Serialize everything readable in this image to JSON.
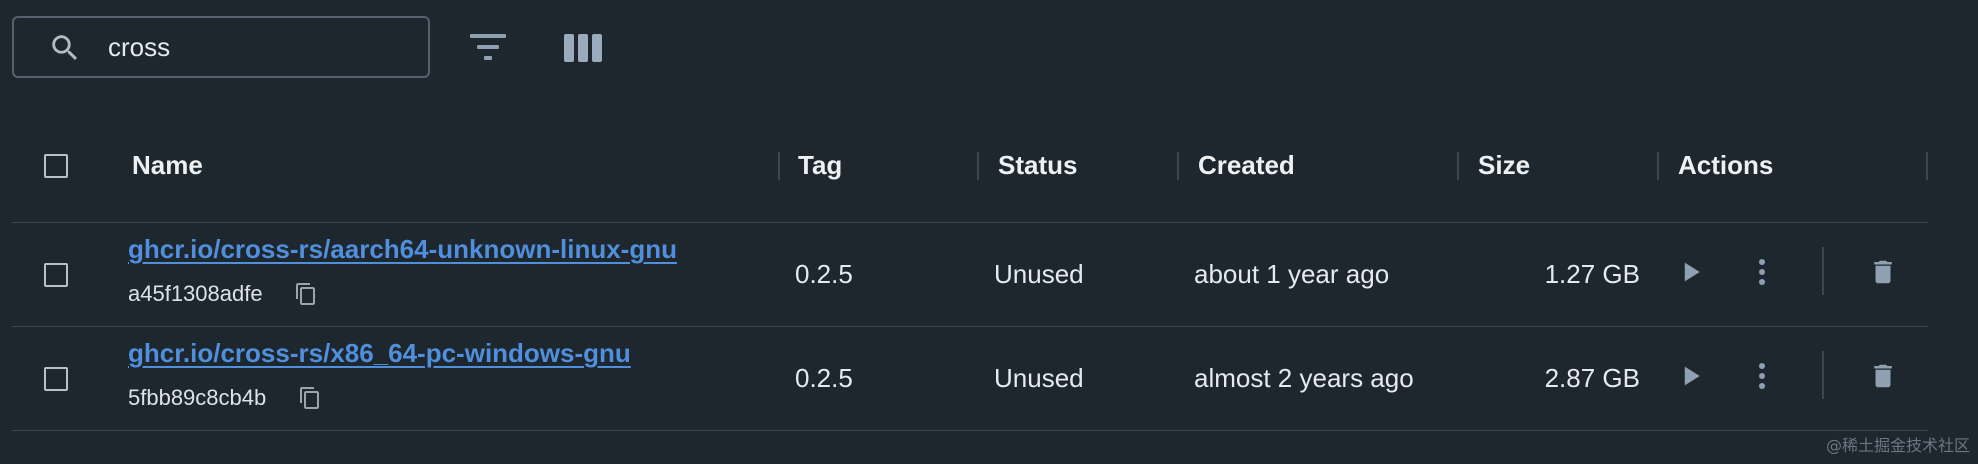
{
  "search": {
    "value": "cross"
  },
  "table": {
    "columns": [
      "Name",
      "Tag",
      "Status",
      "Created",
      "Size",
      "Actions"
    ],
    "rows": [
      {
        "name": "ghcr.io/cross-rs/aarch64-unknown-linux-gnu",
        "id": "a45f1308adfe",
        "tag": "0.2.5",
        "status": "Unused",
        "created": "about 1 year ago",
        "size": "1.27 GB"
      },
      {
        "name": "ghcr.io/cross-rs/x86_64-pc-windows-gnu",
        "id": "5fbb89c8cb4b",
        "tag": "0.2.5",
        "status": "Unused",
        "created": "almost 2 years ago",
        "size": "2.87 GB"
      }
    ]
  },
  "watermark": "@稀土掘金技术社区",
  "icons": {
    "search": "search-icon",
    "filter": "filter-icon",
    "columns": "columns-icon",
    "copy": "copy-icon",
    "run": "play-icon",
    "more": "more-vertical-icon",
    "delete": "trash-icon"
  },
  "colors": {
    "background": "#1e262e",
    "link": "#4f8fdc",
    "text": "#e6eaee",
    "icon": "#8fa0b2"
  }
}
